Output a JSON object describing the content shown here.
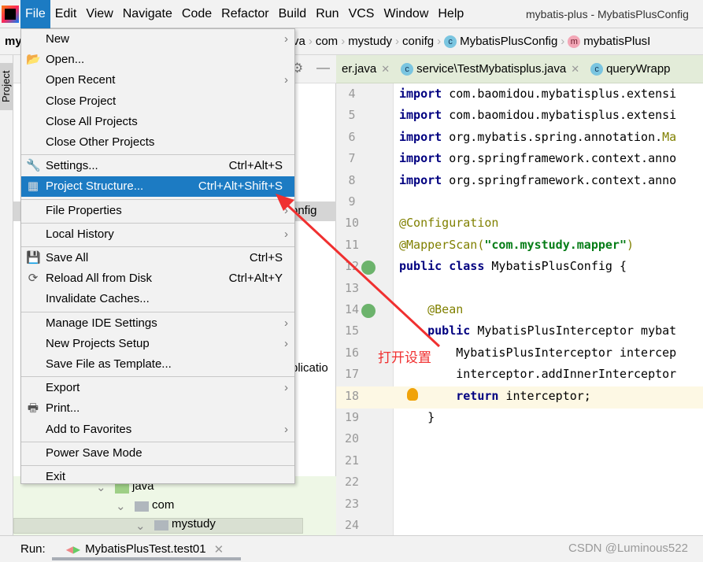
{
  "menubar": {
    "items": [
      "File",
      "Edit",
      "View",
      "Navigate",
      "Code",
      "Refactor",
      "Build",
      "Run",
      "VCS",
      "Window",
      "Help"
    ],
    "active": "File",
    "title": "mybatis-plus - MybatisPlusConfig"
  },
  "breadcrumb": {
    "project": "my",
    "items": [
      "va",
      "com",
      "mystudy",
      "conifg",
      "MybatisPlusConfig",
      "mybatisPlusI"
    ]
  },
  "tool_window": {
    "label": "Project"
  },
  "tabs": [
    {
      "label": "er.java"
    },
    {
      "label": "service\\TestMybatisplus.java"
    },
    {
      "label": "queryWrapp"
    }
  ],
  "project_tree": {
    "partial": [
      "onfig",
      "plicatio"
    ],
    "nodes": [
      "java",
      "com",
      "mystudy"
    ]
  },
  "file_menu": {
    "items": [
      {
        "label": "New",
        "submenu": true
      },
      {
        "label": "Open...",
        "icon": "folder-open-icon"
      },
      {
        "label": "Open Recent",
        "submenu": true
      },
      {
        "label": "Close Project"
      },
      {
        "label": "Close All Projects"
      },
      {
        "label": "Close Other Projects"
      },
      {
        "label": "Settings...",
        "shortcut": "Ctrl+Alt+S",
        "icon": "wrench-icon"
      },
      {
        "label": "Project Structure...",
        "shortcut": "Ctrl+Alt+Shift+S",
        "icon": "project-structure-icon",
        "highlighted": true
      },
      {
        "label": "File Properties",
        "submenu": true
      },
      {
        "label": "Local History",
        "submenu": true
      },
      {
        "label": "Save All",
        "shortcut": "Ctrl+S",
        "icon": "save-icon"
      },
      {
        "label": "Reload All from Disk",
        "shortcut": "Ctrl+Alt+Y",
        "icon": "reload-icon"
      },
      {
        "label": "Invalidate Caches..."
      },
      {
        "label": "Manage IDE Settings",
        "submenu": true
      },
      {
        "label": "New Projects Setup",
        "submenu": true
      },
      {
        "label": "Save File as Template..."
      },
      {
        "label": "Export",
        "submenu": true
      },
      {
        "label": "Print...",
        "icon": "print-icon"
      },
      {
        "label": "Add to Favorites",
        "submenu": true
      },
      {
        "label": "Power Save Mode"
      },
      {
        "label": "Exit"
      }
    ]
  },
  "editor": {
    "lines": [
      {
        "n": "4",
        "code": [
          [
            "kw",
            "import"
          ],
          [
            "",
            "com.baomidou.mybatisplus.extensi"
          ]
        ]
      },
      {
        "n": "5",
        "code": [
          [
            "kw",
            "import"
          ],
          [
            "",
            "com.baomidou.mybatisplus.extensi"
          ]
        ]
      },
      {
        "n": "6",
        "code": [
          [
            "kw",
            "import"
          ],
          [
            "",
            "org.mybatis.spring.annotation."
          ],
          [
            "an",
            "Ma"
          ]
        ]
      },
      {
        "n": "7",
        "code": [
          [
            "kw",
            "import"
          ],
          [
            "",
            "org.springframework.context.anno"
          ]
        ]
      },
      {
        "n": "8",
        "code": [
          [
            "kw",
            "import"
          ],
          [
            "",
            "org.springframework.context.anno"
          ]
        ]
      },
      {
        "n": "9",
        "code": []
      },
      {
        "n": "10",
        "code": [
          [
            "an",
            "@Configuration"
          ]
        ]
      },
      {
        "n": "11",
        "code": [
          [
            "an",
            "@MapperScan("
          ],
          [
            "st",
            "\"com.mystudy.mapper\""
          ],
          [
            "an",
            ")"
          ]
        ]
      },
      {
        "n": "12",
        "code": [
          [
            "kw",
            "public class"
          ],
          [
            "",
            "MybatisPlusConfig {"
          ]
        ]
      },
      {
        "n": "13",
        "code": []
      },
      {
        "n": "14",
        "code": [
          [
            "an",
            "    @Bean"
          ]
        ]
      },
      {
        "n": "15",
        "code": [
          [
            "kw",
            "    public"
          ],
          [
            "",
            "MybatisPlusInterceptor mybat"
          ]
        ]
      },
      {
        "n": "16",
        "code": [
          [
            "",
            "        MybatisPlusInterceptor intercep"
          ]
        ]
      },
      {
        "n": "17",
        "code": [
          [
            "",
            "        interceptor.addInnerInterceptor"
          ]
        ]
      },
      {
        "n": "18",
        "code": [
          [
            "kw",
            "        return"
          ],
          [
            "",
            "interceptor;"
          ]
        ]
      },
      {
        "n": "19",
        "code": [
          [
            "",
            "    }"
          ]
        ]
      },
      {
        "n": "20",
        "code": []
      },
      {
        "n": "21",
        "code": []
      },
      {
        "n": "22",
        "code": []
      },
      {
        "n": "23",
        "code": []
      },
      {
        "n": "24",
        "code": []
      }
    ],
    "current_line": "18"
  },
  "run_bar": {
    "label": "Run:",
    "config": "MybatisPlusTest.test01"
  },
  "annotation": {
    "text": "打开设置",
    "color": "#f03030"
  },
  "watermark": "CSDN @Luminous522",
  "colors": {
    "accent": "#1c7bc3",
    "tab_bar": "#e3ecd9"
  }
}
